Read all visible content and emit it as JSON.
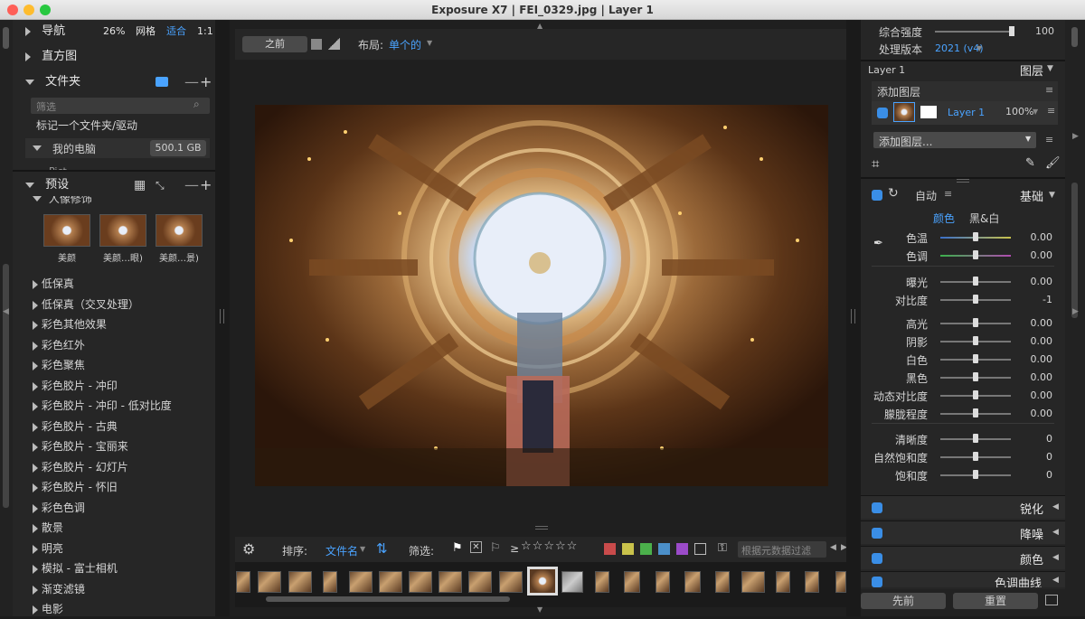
{
  "window": {
    "title": "Exposure X7 | FEI_0329.jpg | Layer 1"
  },
  "left": {
    "nav": {
      "label": "导航",
      "zoom": "26%",
      "grid": "网格",
      "fit": "适合",
      "ratio": "1:1"
    },
    "histogram": {
      "label": "直方图"
    },
    "folders": {
      "label": "文件夹",
      "filter_placeholder": "筛选",
      "mark_text": "标记一个文件夹/驱动",
      "computer": "我的电脑",
      "disk": "500.1 GB",
      "partial": "Pict..."
    },
    "presets": {
      "label": "预设",
      "group_open": "人像修饰",
      "thumbs": [
        "美颜",
        "美颜…眼)",
        "美颜…景)"
      ],
      "items": [
        "低保真",
        "低保真（交叉处理）",
        "彩色其他效果",
        "彩色红外",
        "彩色聚焦",
        "彩色胶片 - 冲印",
        "彩色胶片 - 冲印 - 低对比度",
        "彩色胶片 - 古典",
        "彩色胶片 - 宝丽来",
        "彩色胶片 - 幻灯片",
        "彩色胶片 - 怀旧",
        "彩色色调",
        "散景",
        "明亮",
        "模拟 - 富士相机",
        "渐变滤镜",
        "电影"
      ]
    }
  },
  "center": {
    "before_button": "之前",
    "layout_label": "布局:",
    "layout_value": "单个的",
    "sort_label": "排序:",
    "sort_value": "文件名",
    "filter_label": "筛选:",
    "rating_op": "≥",
    "metadata_placeholder": "根据元数据过滤",
    "color_chips": [
      "#c94b4b",
      "#c9c24b",
      "#4bb04b",
      "#4b8fc9",
      "#9b4bc9"
    ]
  },
  "right": {
    "overall_strength": {
      "label": "综合强度",
      "value": "100"
    },
    "process_version": {
      "label": "处理版本",
      "value": "2021 (v4)"
    },
    "layers": {
      "current": "Layer 1",
      "title": "图层",
      "add_layer": "添加图层",
      "layer_name": "Layer 1",
      "opacity": "100%",
      "add_layer_dropdown": "添加图层..."
    },
    "basic": {
      "auto": "自动",
      "title": "基础",
      "color_tab": "颜色",
      "bw_tab": "黑&白"
    },
    "sliders": [
      {
        "label": "色温",
        "value": "0.00"
      },
      {
        "label": "色调",
        "value": "0.00"
      },
      {
        "label": "曝光",
        "value": "0.00"
      },
      {
        "label": "对比度",
        "value": "-1"
      },
      {
        "label": "高光",
        "value": "0.00"
      },
      {
        "label": "阴影",
        "value": "0.00"
      },
      {
        "label": "白色",
        "value": "0.00"
      },
      {
        "label": "黑色",
        "value": "0.00"
      },
      {
        "label": "动态对比度",
        "value": "0.00"
      },
      {
        "label": "朦胧程度",
        "value": "0.00"
      },
      {
        "label": "清晰度",
        "value": "0"
      },
      {
        "label": "自然饱和度",
        "value": "0"
      },
      {
        "label": "饱和度",
        "value": "0"
      }
    ],
    "panels": [
      "锐化",
      "降噪",
      "颜色",
      "色调曲线"
    ],
    "prev_button": "先前",
    "reset_button": "重置"
  }
}
